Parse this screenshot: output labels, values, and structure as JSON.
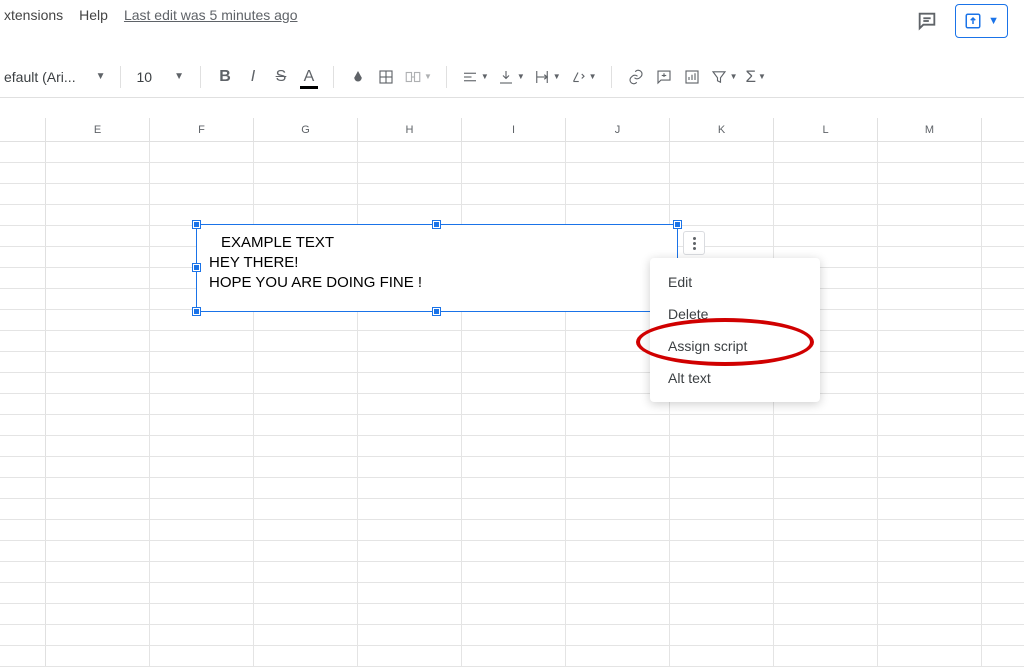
{
  "menu": {
    "extensions": "xtensions",
    "help": "Help",
    "edit_hint": "Last edit was 5 minutes ago"
  },
  "toolbar": {
    "font_family": "efault (Ari...",
    "font_size": "10"
  },
  "columns": [
    "E",
    "F",
    "G",
    "H",
    "I",
    "J",
    "K",
    "L",
    "M"
  ],
  "textbox": {
    "line1": "EXAMPLE TEXT",
    "line2": "HEY THERE!",
    "line3": "HOPE YOU ARE DOING FINE !"
  },
  "context_menu": {
    "edit": "Edit",
    "delete": "Delete",
    "assign_script": "Assign script",
    "alt_text": "Alt text"
  }
}
